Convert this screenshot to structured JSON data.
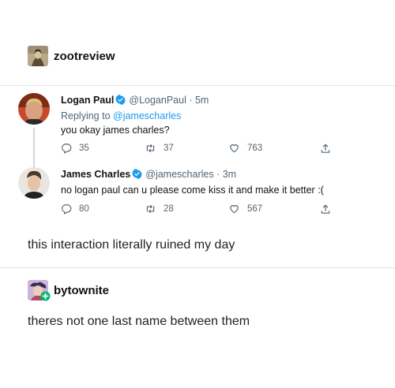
{
  "post1": {
    "username": "zootreview",
    "avatar_icon": "mona-lisa-avatar-icon",
    "caption": "this interaction literally ruined my day",
    "tweets": [
      {
        "name": "Logan Paul",
        "handle": "@LoganPaul",
        "time": "· 5m",
        "replying_prefix": "Replying to ",
        "replying_handle": "@jamescharles",
        "text": "you okay james charles?",
        "replies": "35",
        "retweets": "37",
        "likes": "763"
      },
      {
        "name": "James Charles",
        "handle": "@jamescharles",
        "time": "· 3m",
        "text": "no logan paul can u please come kiss it and make it better :(",
        "replies": "80",
        "retweets": "28",
        "likes": "567"
      }
    ]
  },
  "post2": {
    "username": "bytownite",
    "avatar_icon": "bytownite-avatar-icon",
    "text": "theres not one last name between them"
  },
  "colors": {
    "verified": "#1d9bf0",
    "muted": "#536471",
    "mention": "#1d9bf0",
    "divider": "#e3e3e3"
  }
}
